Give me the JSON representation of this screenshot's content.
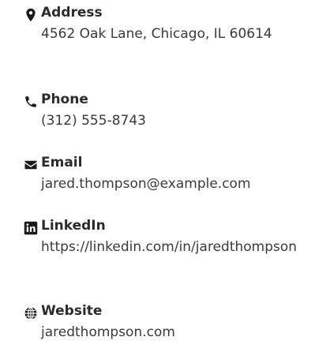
{
  "contacts": [
    {
      "label": "Address",
      "value": "4562 Oak Lane, Chicago, IL 60614",
      "icon": "map-pin-icon"
    },
    {
      "label": "Phone",
      "value": "(312) 555-8743",
      "icon": "phone-icon"
    },
    {
      "label": "Email",
      "value": "jared.thompson@example.com",
      "icon": "envelope-icon"
    },
    {
      "label": "LinkedIn",
      "value": "https://linkedin.com/in/jaredthompson",
      "icon": "linkedin-icon"
    },
    {
      "label": "Website",
      "value": "jaredthompson.com",
      "icon": "globe-icon"
    }
  ],
  "colors": {
    "icon": "#1a1a1a",
    "label": "#2b2b2b",
    "value": "#3a3a3a"
  }
}
